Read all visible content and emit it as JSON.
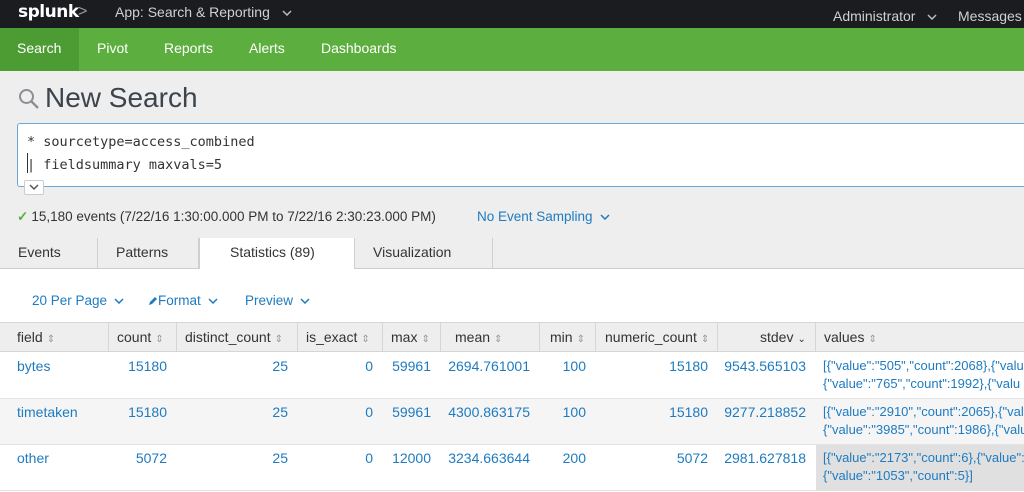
{
  "topbar": {
    "logo": "splunk",
    "logo_suffix": ">",
    "app_label": "App: Search & Reporting",
    "user": "Administrator",
    "messages": "Messages"
  },
  "nav": {
    "items": [
      {
        "label": "Search",
        "active": true
      },
      {
        "label": "Pivot"
      },
      {
        "label": "Reports"
      },
      {
        "label": "Alerts"
      },
      {
        "label": "Dashboards"
      }
    ]
  },
  "page_title": "New Search",
  "query": {
    "line1": "* sourcetype=access_combined",
    "line2": "| fieldsummary maxvals=5"
  },
  "summary": {
    "check": "✓",
    "text": "15,180 events (7/22/16 1:30:00.000 PM to 7/22/16 2:30:23.000 PM)",
    "sampling": "No Event Sampling"
  },
  "tabs": [
    {
      "label": "Events"
    },
    {
      "label": "Patterns"
    },
    {
      "label": "Statistics (89)",
      "active": true
    },
    {
      "label": "Visualization"
    }
  ],
  "controls": {
    "per_page": "20 Per Page",
    "format": "Format",
    "preview": "Preview"
  },
  "table": {
    "columns": [
      "field",
      "count",
      "distinct_count",
      "is_exact",
      "max",
      "mean",
      "min",
      "numeric_count",
      "stdev",
      "values"
    ],
    "sorted_column": "stdev",
    "rows": [
      {
        "field": "bytes",
        "count": "15180",
        "distinct_count": "25",
        "is_exact": "0",
        "max": "59961",
        "mean": "2694.761001",
        "min": "100",
        "numeric_count": "15180",
        "stdev": "9543.565103",
        "values_line1": "[{\"value\":\"505\",\"count\":2068},{\"valu",
        "values_line2": "{\"value\":\"765\",\"count\":1992},{\"valu"
      },
      {
        "field": "timetaken",
        "count": "15180",
        "distinct_count": "25",
        "is_exact": "0",
        "max": "59961",
        "mean": "4300.863175",
        "min": "100",
        "numeric_count": "15180",
        "stdev": "9277.218852",
        "values_line1": "[{\"value\":\"2910\",\"count\":2065},{\"val",
        "values_line2": "{\"value\":\"3985\",\"count\":1986},{\"valu"
      },
      {
        "field": "other",
        "count": "5072",
        "distinct_count": "25",
        "is_exact": "0",
        "max": "12000",
        "mean": "3234.663644",
        "min": "200",
        "numeric_count": "5072",
        "stdev": "2981.627818",
        "values_line1": "[{\"value\":\"2173\",\"count\":6},{\"value\":",
        "values_line2": "{\"value\":\"1053\",\"count\":5}]"
      }
    ]
  }
}
